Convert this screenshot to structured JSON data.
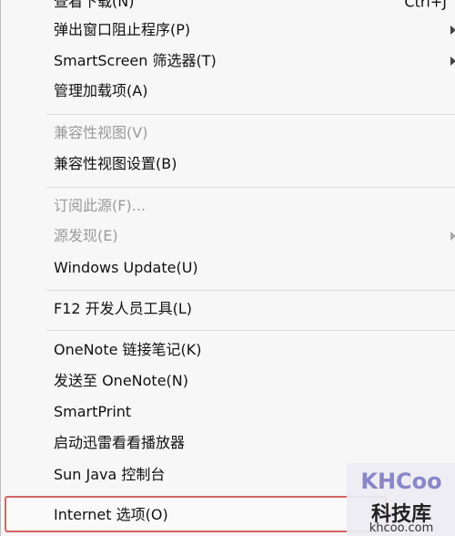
{
  "menu": {
    "items": [
      {
        "label": "查看下载(N)",
        "shortcut": "Ctrl+J"
      },
      {
        "label": "弹出窗口阻止程序(P)"
      },
      {
        "label": "SmartScreen 筛选器(T)"
      },
      {
        "label": "管理加载项(A)"
      },
      {
        "label": "兼容性视图(V)"
      },
      {
        "label": "兼容性视图设置(B)"
      },
      {
        "label": "订阅此源(F)..."
      },
      {
        "label": "源发现(E)"
      },
      {
        "label": "Windows Update(U)"
      },
      {
        "label": "F12 开发人员工具(L)"
      },
      {
        "label": "OneNote 链接笔记(K)"
      },
      {
        "label": "发送至 OneNote(N)"
      },
      {
        "label": "SmartPrint"
      },
      {
        "label": "启动迅雷看看播放器"
      },
      {
        "label": "Sun Java 控制台"
      },
      {
        "label": "Internet 选项(O)"
      }
    ]
  },
  "watermark": {
    "logo": "KHCoo",
    "name": "科技库",
    "url": "khcoo.com"
  },
  "colors": {
    "menu_bg": "#f7f7f7",
    "disabled_text": "#9a9a9a",
    "highlight_border": "#d46565",
    "watermark_logo": "#8a86c8"
  }
}
